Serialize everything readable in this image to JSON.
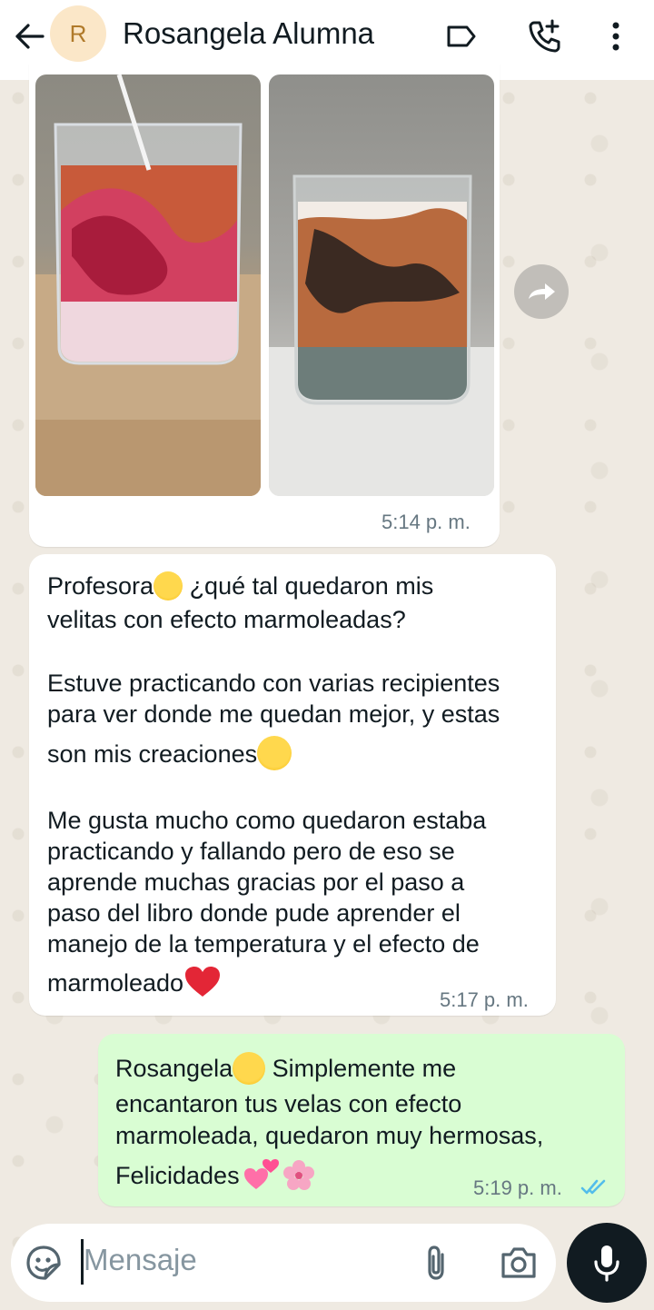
{
  "header": {
    "avatar_letter": "R",
    "contact_name": "Rosangela Alumna",
    "icons": [
      "back-arrow-icon",
      "label-icon",
      "add-call-icon",
      "more-vert-icon"
    ]
  },
  "messages": [
    {
      "direction": "incoming",
      "type": "images",
      "image_count": 2,
      "time": "5:14 p. m."
    },
    {
      "direction": "incoming",
      "type": "text",
      "lines": [
        "Profesora",
        " ¿qué tal quedaron mis",
        "velitas con efecto marmoleadas?",
        "Estuve practicando con varias recipientes",
        "para ver donde me quedan mejor, y estas",
        "son mis creaciones",
        "Me gusta mucho como quedaron estaba",
        "practicando y fallando pero de eso se",
        "aprende muchas gracias por el paso a",
        "paso del libro donde pude aprender el",
        "manejo de la temperatura y el efecto de",
        "marmoleado"
      ],
      "time": "5:17 p. m."
    },
    {
      "direction": "outgoing",
      "type": "text",
      "lines": [
        "Rosangela",
        " Simplemente me",
        "encantaron tus velas con efecto",
        "marmoleada, quedaron muy hermosas,",
        "Felicidades"
      ],
      "time": "5:19 p. m.",
      "status": "read"
    }
  ],
  "composer": {
    "placeholder": "Mensaje",
    "icons": [
      "sticker-icon",
      "attach-icon",
      "camera-icon",
      "mic-icon"
    ]
  },
  "colors": {
    "wallpaper": "#efeae2",
    "outgoing_bubble": "#d9fdd3",
    "incoming_bubble": "#ffffff",
    "read_ticks": "#53bdeb",
    "mic_button": "#111b21"
  }
}
